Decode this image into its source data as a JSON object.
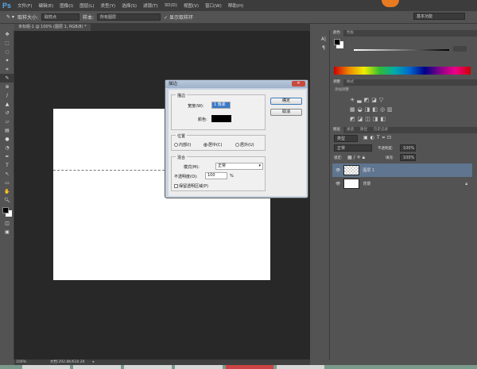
{
  "app": {
    "logo": "Ps",
    "menus": [
      "文件(F)",
      "编辑(E)",
      "图像(I)",
      "图层(L)",
      "类型(Y)",
      "选择(S)",
      "滤镜(T)",
      "3D(D)",
      "视图(V)",
      "窗口(W)",
      "帮助(H)"
    ]
  },
  "options": {
    "sample_size_label": "取样大小:",
    "sample_size": "取样点",
    "sample_label": "样本:",
    "sample": "所有图层",
    "show_ring": "显示取样环",
    "workspace": "基本功能"
  },
  "document": {
    "tab": "未标题-1 @ 100% (图层 1, RGB/8) *",
    "zoom": "100%",
    "doc_info": "文档:292.8K/610.2K"
  },
  "dialog": {
    "title": "描边",
    "stroke_group": "描边",
    "width_label": "宽度(W):",
    "width_value": "1 像素",
    "color_label": "颜色:",
    "color": "#000000",
    "position_group": "位置",
    "inside": "内部(I)",
    "center": "居中(C)",
    "outside": "居外(U)",
    "selected_position": "center",
    "blend_group": "混合",
    "mode_label": "模式(M):",
    "mode": "正常",
    "opacity_label": "不透明度(O):",
    "opacity": "100",
    "percent": "%",
    "preserve": "保留透明区域(P)",
    "preserve_checked": false,
    "ok": "确定",
    "cancel": "取消"
  },
  "panels": {
    "color_tabs": [
      "颜色",
      "色板"
    ],
    "adjust_tabs": [
      "调整",
      "样式"
    ],
    "add_adjust": "添加调整",
    "layer_tabs": [
      "图层",
      "通道",
      "路径",
      "历史记录"
    ],
    "kind": "类型",
    "blend": "正常",
    "opacity_label": "不透明度:",
    "opacity": "100%",
    "lock_label": "锁定:",
    "fill_label": "填充:",
    "fill": "100%",
    "layers": [
      {
        "name": "图层 1",
        "selected": true
      },
      {
        "name": "背景",
        "locked": true
      }
    ]
  }
}
